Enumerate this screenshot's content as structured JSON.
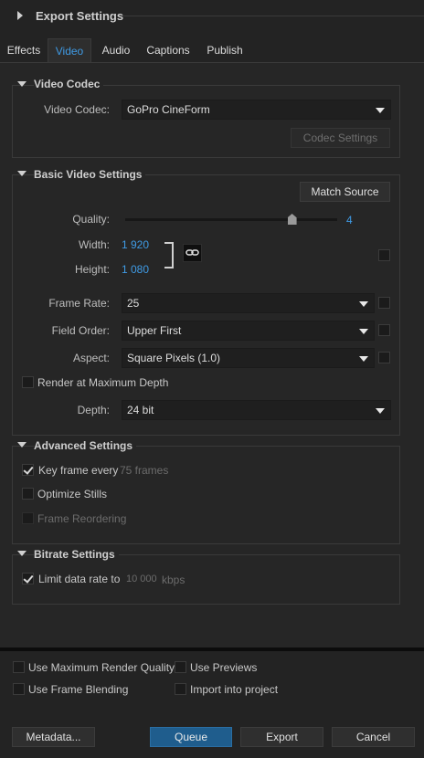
{
  "export_settings": {
    "title": "Export Settings"
  },
  "tabs": [
    {
      "label": "Effects"
    },
    {
      "label": "Video"
    },
    {
      "label": "Audio"
    },
    {
      "label": "Captions"
    },
    {
      "label": "Publish"
    }
  ],
  "video_codec": {
    "header": "Video Codec",
    "codec_label": "Video Codec:",
    "codec_value": "GoPro CineForm",
    "codec_settings_button": "Codec Settings"
  },
  "basic_video": {
    "header": "Basic Video Settings",
    "match_source_button": "Match Source",
    "quality_label": "Quality:",
    "quality_value": "4",
    "quality_fraction": 0.8,
    "width_label": "Width:",
    "width_value": "1 920",
    "height_label": "Height:",
    "height_value": "1 080",
    "frame_rate_label": "Frame Rate:",
    "frame_rate_value": "25",
    "field_order_label": "Field Order:",
    "field_order_value": "Upper First",
    "aspect_label": "Aspect:",
    "aspect_value": "Square Pixels (1.0)",
    "render_max_depth_label": "Render at Maximum Depth",
    "depth_label": "Depth:",
    "depth_value": "24 bit"
  },
  "advanced": {
    "header": "Advanced Settings",
    "key_frame_label": "Key frame every",
    "key_frame_value": "75 frames",
    "optimize_stills_label": "Optimize Stills",
    "frame_reordering_label": "Frame Reordering"
  },
  "bitrate": {
    "header": "Bitrate Settings",
    "limit_label": "Limit data rate to",
    "limit_value": "10 000",
    "limit_unit": "kbps"
  },
  "footer": {
    "use_max_render_quality": "Use Maximum Render Quality",
    "use_previews": "Use Previews",
    "use_frame_blending": "Use Frame Blending",
    "import_into_project": "Import into project",
    "metadata_button": "Metadata...",
    "queue_button": "Queue",
    "export_button": "Export",
    "cancel_button": "Cancel"
  },
  "colors": {
    "accent": "#3f9be5",
    "primary_button": "#1f5d8d",
    "background": "#232323"
  }
}
